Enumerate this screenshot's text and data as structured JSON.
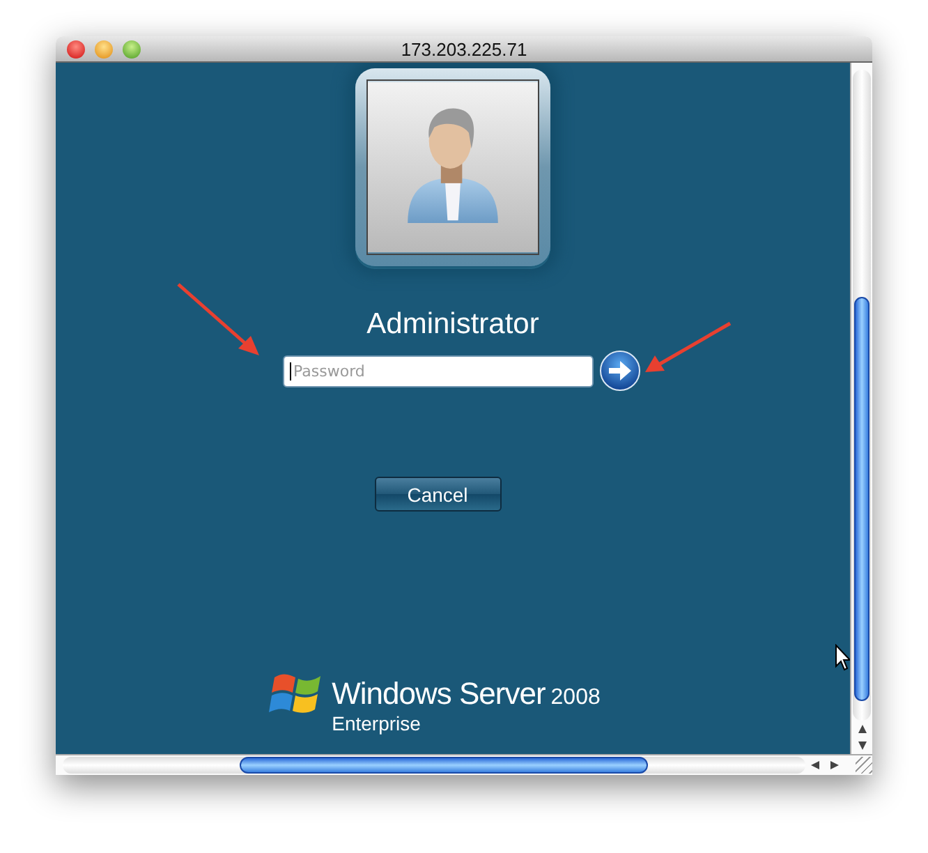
{
  "window": {
    "title": "173.203.225.71"
  },
  "login": {
    "user_name": "Administrator",
    "password": {
      "placeholder": "Password",
      "focused": true
    }
  },
  "buttons": [
    {
      "label": "Cancel"
    }
  ],
  "branding": {
    "product": "Windows Server",
    "version": "2008",
    "edition": "Enterprise"
  }
}
